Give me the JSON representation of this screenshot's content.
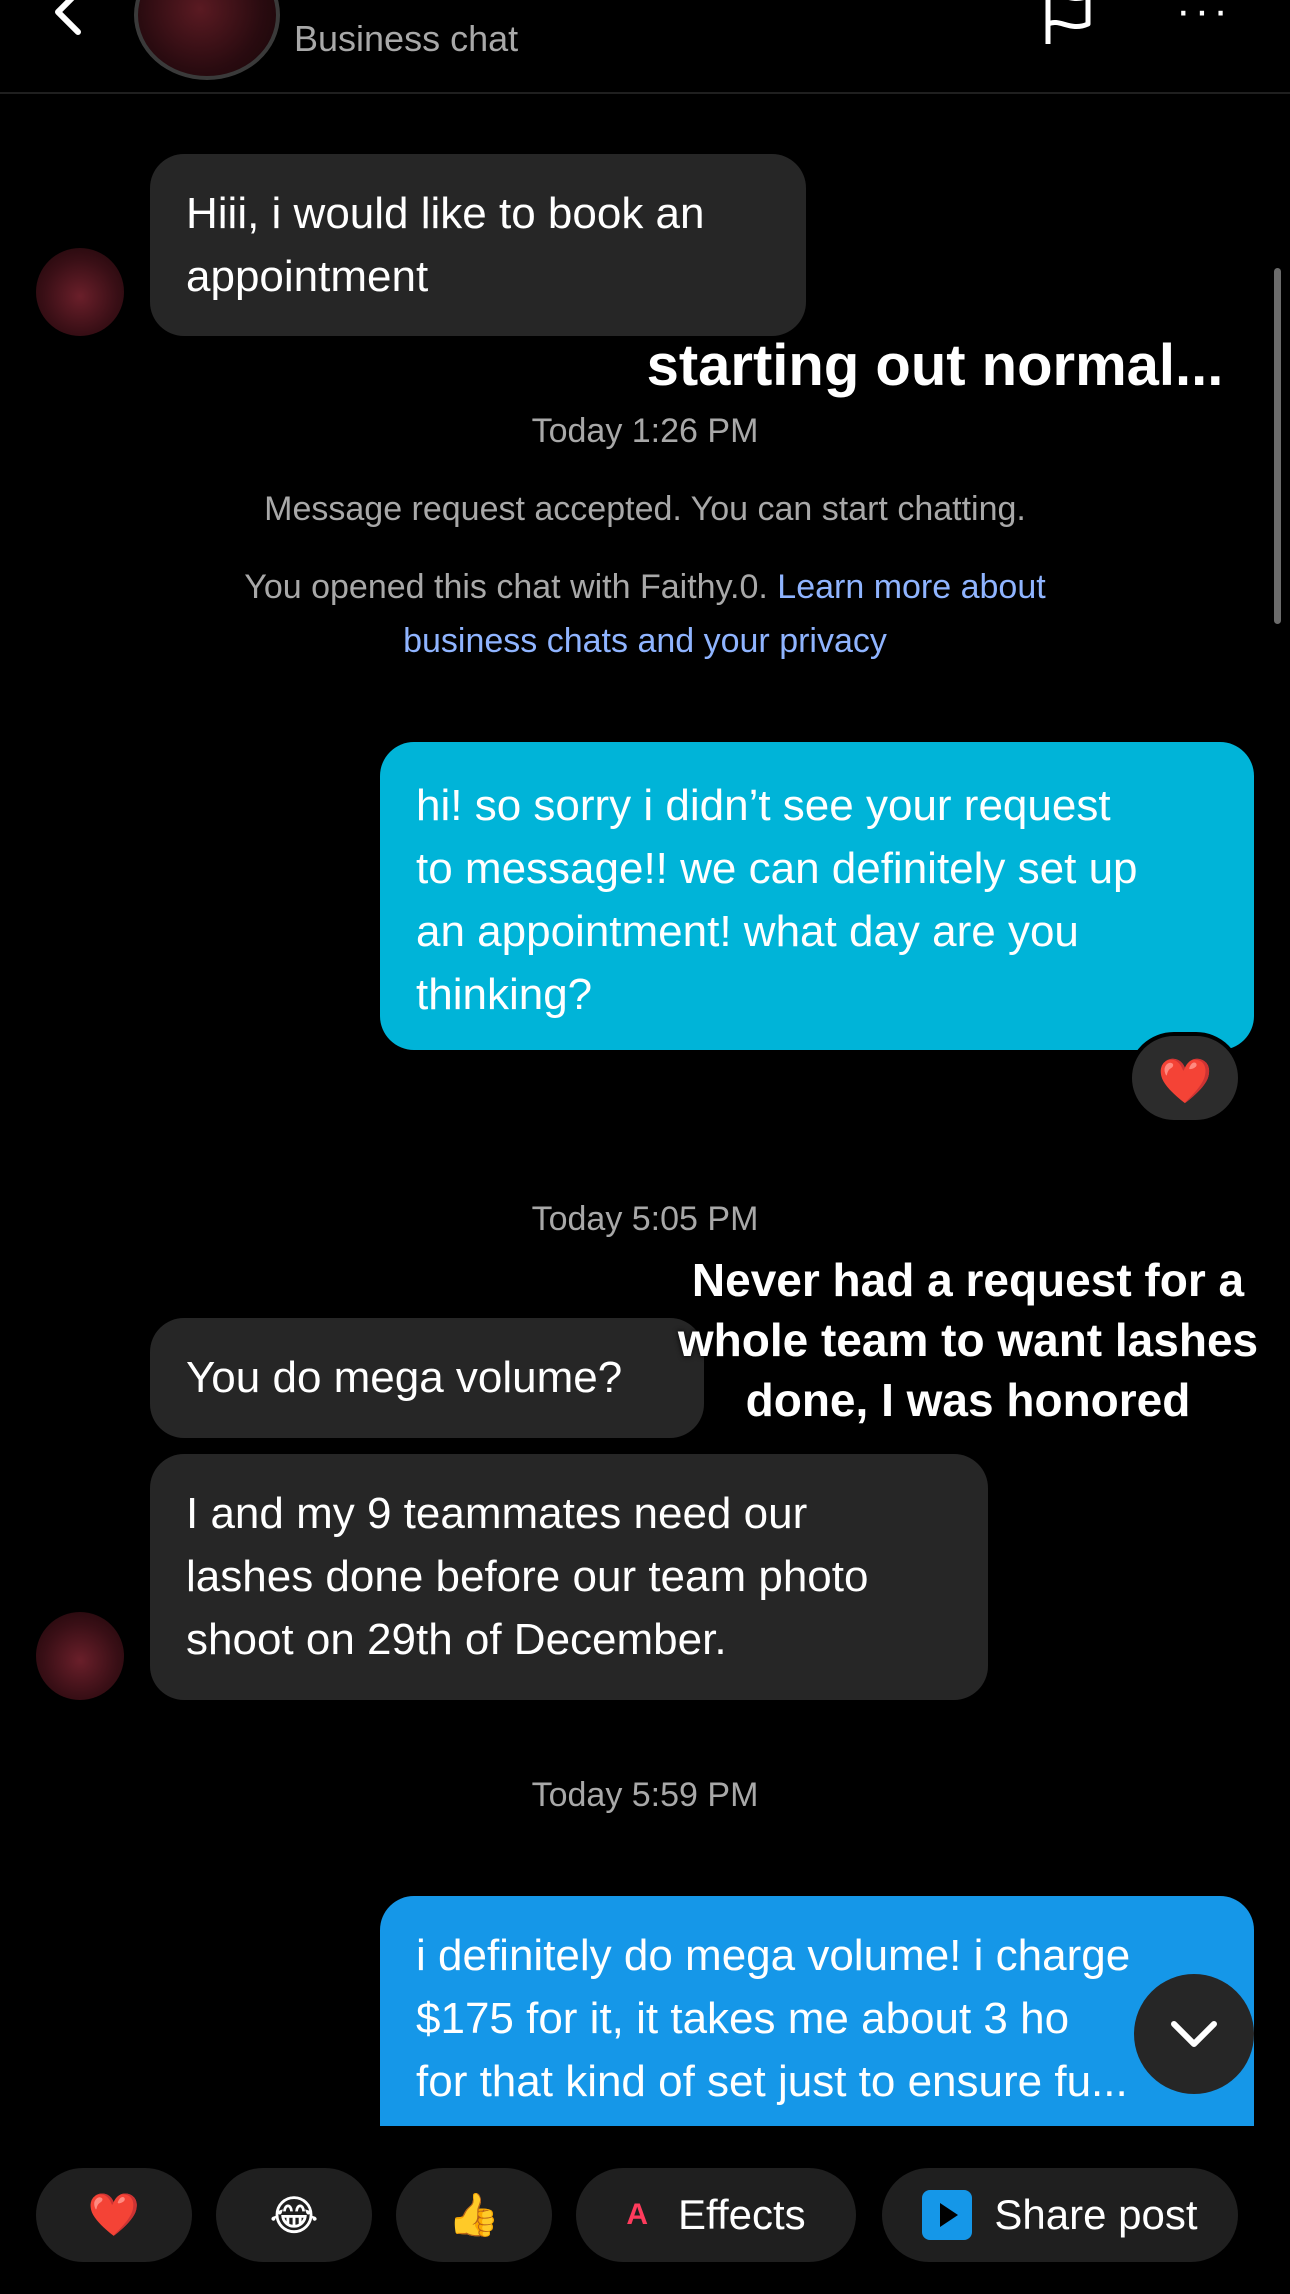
{
  "header": {
    "subtitle": "Business chat",
    "back_icon": "chevron-left-icon",
    "flag_icon": "flag-icon",
    "more_icon": "more-horizontal-icon",
    "more_glyph": "···"
  },
  "messages": {
    "m1": "Hiii, i would like to book an appointment",
    "m1_line1": "Hiii, i would like to book an",
    "m1_line2": "appointment",
    "ts1": "Today 1:26 PM",
    "sys1": "Message request accepted. You can start chatting.",
    "sys2_plain": "You opened this chat with Faithy.0. ",
    "sys2_link_a": "Learn more about",
    "sys2_link_b": "business chats and your privacy",
    "out1_l1": "hi! so sorry i didn’t see your request",
    "out1_l2": "to message!! we can definitely set up",
    "out1_l3": "an appointment! what day are you",
    "out1_l4": "thinking?",
    "reaction": "❤️",
    "ts2": "Today 5:05 PM",
    "m2": "You do mega volume?",
    "m3_l1": "I and my 9 teammates need our",
    "m3_l2": "lashes done before our team photo",
    "m3_l3": "shoot on 29th of December.",
    "ts3": "Today 5:59 PM",
    "out2_l1": "i definitely do mega volume! i charge",
    "out2_l2": "$175 for it, it takes me about 3 ho",
    "out2_l3": "for that kind of set just to ensure fu..."
  },
  "overlays": {
    "o1": "starting out normal...",
    "o2_l1": "Never had a request for a",
    "o2_l2": "whole team to want lashes",
    "o2_l3": "done, I was honored"
  },
  "bottom_bar": {
    "heart": "❤️",
    "laugh": "😂",
    "thumbs": "👍",
    "effects_label": "Effects",
    "effects_icon_glyph": "A",
    "share_label": "Share post"
  },
  "colors": {
    "incoming": "#262626",
    "outgoing_1": "#00b4d8",
    "outgoing_2": "#1597e8",
    "link": "#8fb4ff"
  }
}
